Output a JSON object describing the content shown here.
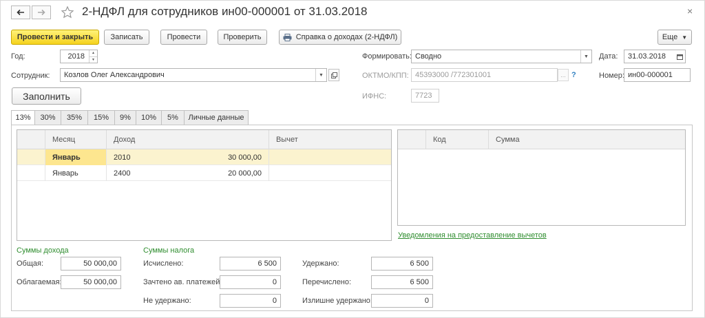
{
  "header": {
    "title": "2-НДФЛ для сотрудников ин00-000001 от 31.03.2018",
    "back_icon": "arrow-left-icon",
    "forward_icon": "arrow-right-icon",
    "favorite_icon": "star-icon",
    "close_glyph": "×"
  },
  "toolbar": {
    "post_close": "Провести и закрыть",
    "save": "Записать",
    "post": "Провести",
    "check": "Проверить",
    "income_cert": "Справка о доходах (2-НДФЛ)",
    "more": "Еще",
    "more_caret": "▼"
  },
  "form": {
    "year_label": "Год:",
    "year_value": "2018",
    "employee_label": "Сотрудник:",
    "employee_value": "Козлов Олег Александрович",
    "fill_button": "Заполнить",
    "generate_label": "Формировать:",
    "generate_value": "Сводно",
    "oktmo_label": "ОКТМО/КПП:",
    "oktmo_value": "45393000   /772301001",
    "oktmo_select": "...",
    "help": "?",
    "ifns_label": "ИФНС:",
    "ifns_value": "7723",
    "date_label": "Дата:",
    "date_value": "31.03.2018",
    "number_label": "Номер:",
    "number_value": "ин00-000001"
  },
  "tabs": [
    {
      "label": "13%",
      "active": true
    },
    {
      "label": "30%",
      "active": false
    },
    {
      "label": "35%",
      "active": false
    },
    {
      "label": "15%",
      "active": false
    },
    {
      "label": "9%",
      "active": false
    },
    {
      "label": "10%",
      "active": false
    },
    {
      "label": "5%",
      "active": false
    },
    {
      "label": "Личные данные",
      "active": false
    }
  ],
  "income_table": {
    "columns": [
      "Месяц",
      "Доход",
      "Вычет"
    ],
    "rows": [
      {
        "month": "Январь",
        "code": "2010",
        "amount": "30 000,00",
        "deduction": "",
        "selected": true
      },
      {
        "month": "Январь",
        "code": "2400",
        "amount": "20 000,00",
        "deduction": "",
        "selected": false
      }
    ]
  },
  "deduction_table": {
    "columns": [
      "Код",
      "Сумма"
    ],
    "rows": []
  },
  "notices_link": "Уведомления на предоставление вычетов",
  "income_sums": {
    "heading": "Суммы дохода",
    "total_label": "Общая:",
    "total_value": "50 000,00",
    "taxable_label": "Облагаемая:",
    "taxable_value": "50 000,00"
  },
  "tax_sums": {
    "heading": "Суммы налога",
    "calculated_label": "Исчислено:",
    "calculated_value": "6 500",
    "advance_label": "Зачтено ав. платежей:",
    "advance_value": "0",
    "not_withheld_label": "Не удержано:",
    "not_withheld_value": "0",
    "withheld_label": "Удержано:",
    "withheld_value": "6 500",
    "transferred_label": "Перечислено:",
    "transferred_value": "6 500",
    "excess_label": "Излишне удержано:",
    "excess_value": "0"
  },
  "colors": {
    "primary_button": "#f5d21e",
    "selected_row": "#fbf3cf",
    "green_text": "#2f8d2f"
  }
}
